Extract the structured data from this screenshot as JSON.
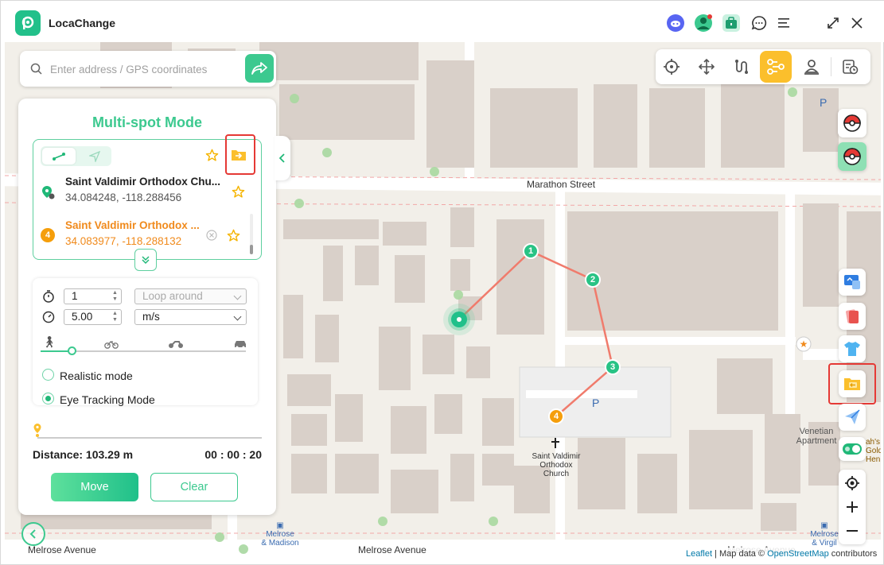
{
  "app": {
    "title": "LocaChange"
  },
  "search": {
    "placeholder": "Enter address / GPS coordinates"
  },
  "panel": {
    "title": "Multi-spot Mode",
    "spots": [
      {
        "name": "Saint Valdimir Orthodox Chu...",
        "coords": "34.084248, -118.288456"
      },
      {
        "name": "Saint Valdimir Orthodox ...",
        "coords": "34.083977, -118.288132",
        "index": "4"
      }
    ],
    "settings": {
      "repeat_count": "1",
      "loop_mode": "Loop around",
      "speed": "5.00",
      "speed_unit": "m/s",
      "speed_level": 0.15,
      "realistic_mode_label": "Realistic mode",
      "eye_tracking_label": "Eye Tracking Mode"
    },
    "distance": "Distance: 103.29 m",
    "timer": "00 : 00 : 20",
    "move_label": "Move",
    "clear_label": "Clear"
  },
  "map": {
    "labels": {
      "marathon": "Marathon Street",
      "melrose_left": "Melrose Avenue",
      "melrose_mid": "Melrose Avenue",
      "melrose_right": "Melrose Avenue",
      "church_1": "Saint Valdimir",
      "church_2": "Orthodox",
      "church_3": "Church",
      "bus_madison_1": "Melrose",
      "bus_madison_2": "& Madison",
      "bus_virgil_1": "Melrose",
      "bus_virgil_2": "& Virgil",
      "venetian_1": "Venetian",
      "venetian_2": "Apartment",
      "cut_1": "ah's",
      "cut_2": "Golde",
      "cut_3": "Hen",
      "parking": "P"
    },
    "waypoints": [
      "1",
      "2",
      "3",
      "4"
    ],
    "attribution": {
      "leaflet": "Leaflet",
      "sep": " | Map data © ",
      "osm": "OpenStreetMap",
      "contrib": " contributors"
    }
  },
  "colors": {
    "accent": "#3cc98f",
    "route": "#f07b6c",
    "highlight": "#e53935",
    "active_mode": "#fbbf2c"
  }
}
